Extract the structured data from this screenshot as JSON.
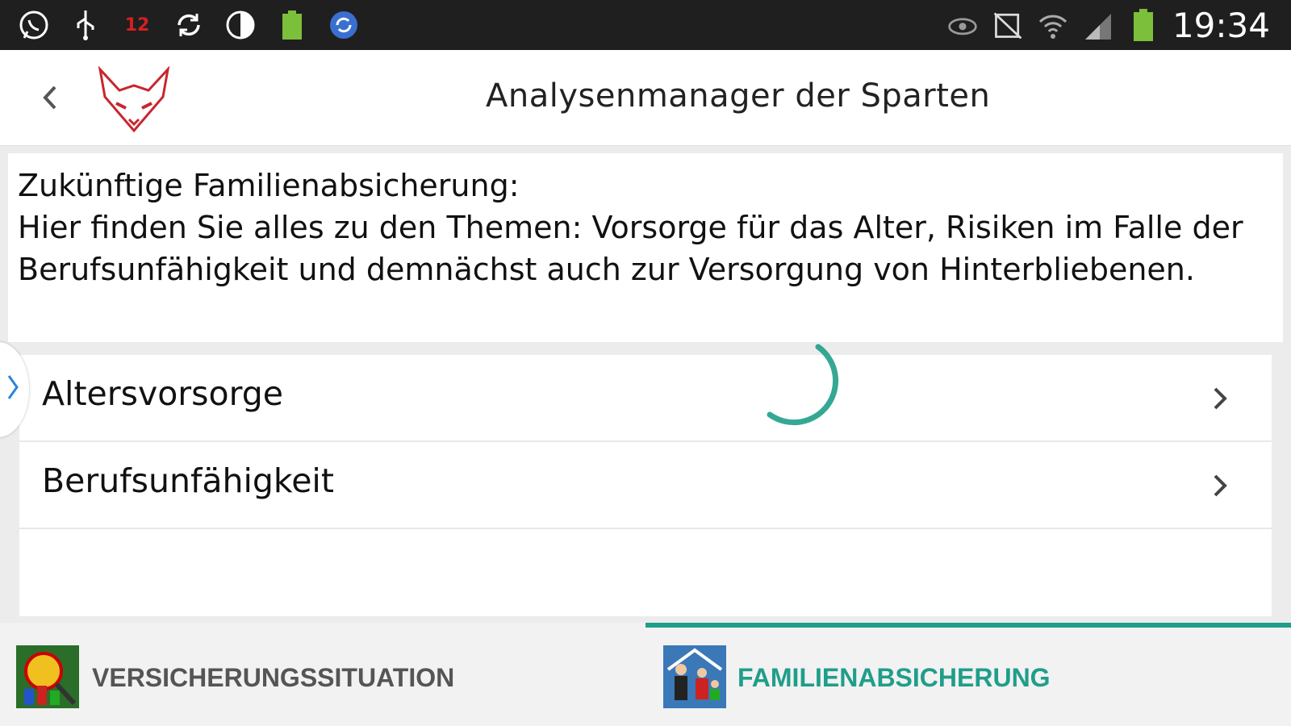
{
  "status_bar": {
    "time": "19:34",
    "badge": "12",
    "left_icons": [
      "whatsapp-icon",
      "usb-icon",
      "badge-icon",
      "sync-icon",
      "contrast-icon",
      "battery-green-icon",
      "refresh-circle-icon"
    ],
    "right_icons": [
      "eye-icon",
      "no-nfc-icon",
      "wifi-icon",
      "signal-icon",
      "battery-icon"
    ]
  },
  "action_bar": {
    "title": "Analysenmanager der Sparten"
  },
  "description": {
    "heading": "Zukünftige Familienabsicherung:",
    "body": "Hier finden Sie alles zu den Themen: Vorsorge für das Alter, Risiken im Falle der Berufsunfähigkeit und demnächst auch zur Versorgung von Hinterbliebenen."
  },
  "list": {
    "items": [
      {
        "label": "Altersvorsorge"
      },
      {
        "label": "Berufsunfähigkeit"
      }
    ]
  },
  "tabs": [
    {
      "label": "VERSICHERUNGSSITUATION",
      "selected": false
    },
    {
      "label": "FAMILIENABSICHERUNG",
      "selected": true
    }
  ],
  "colors": {
    "accent": "#1f9e8a",
    "status_bar": "#1f1f1f",
    "logo": "#c8262e"
  }
}
